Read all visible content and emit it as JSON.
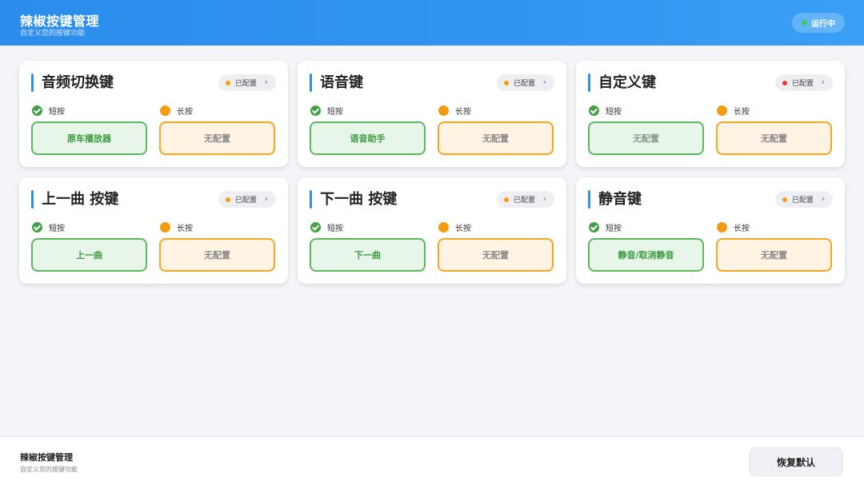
{
  "header": {
    "title": "辣椒按键管理",
    "subtitle": "自定义您的按键功能",
    "status": "运行中",
    "status_color": "#3cc46a"
  },
  "labels": {
    "short": "短按",
    "long": "长按"
  },
  "cards": [
    {
      "title": "音频切换键",
      "badge": "已配置",
      "badge_dot": "#f39c12",
      "short_value": "原车播放器",
      "long_value": "无配置"
    },
    {
      "title": "语音键",
      "badge": "已配置",
      "badge_dot": "#f39c12",
      "short_value": "语音助手",
      "long_value": "无配置"
    },
    {
      "title": "自定义键",
      "badge": "已配置",
      "badge_dot": "#e53935",
      "short_value": "无配置",
      "long_value": "无配置"
    },
    {
      "title": "上一曲 按键",
      "badge": "已配置",
      "badge_dot": "#f39c12",
      "short_value": "上一曲",
      "long_value": "无配置"
    },
    {
      "title": "下一曲 按键",
      "badge": "已配置",
      "badge_dot": "#f39c12",
      "short_value": "下一曲",
      "long_value": "无配置"
    },
    {
      "title": "静音键",
      "badge": "已配置",
      "badge_dot": "#f39c12",
      "short_value": "静音/取消静音",
      "long_value": "无配置"
    }
  ],
  "footer": {
    "title": "辣椒按键管理",
    "subtitle": "自定义您的按键功能",
    "reset_label": "恢复默认"
  }
}
